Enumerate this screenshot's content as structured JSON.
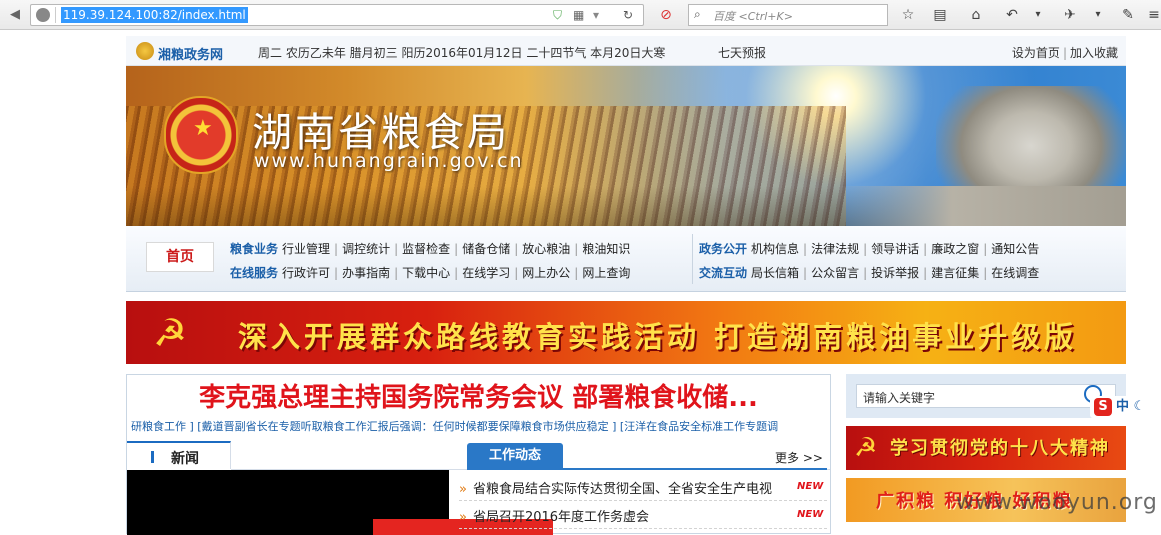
{
  "browser": {
    "url": "119.39.124.100:82/index.html",
    "search_placeholder": "百度 <Ctrl+K>"
  },
  "topbar": {
    "site_name": "湘粮政务网",
    "date": "周二 农历乙未年 腊月初三 阳历2016年01月12日 二十四节气 本月20日大寒",
    "weather": "七天预报",
    "link_homepage": "设为首页",
    "link_favorite": "加入收藏"
  },
  "banner": {
    "title": "湖南省粮食局",
    "domain": "www.hunangrain.gov.cn"
  },
  "nav": {
    "home": "首页",
    "row1_cat": "粮食业务",
    "row1_items": [
      "行业管理",
      "调控统计",
      "监督检查",
      "储备仓储",
      "放心粮油",
      "粮油知识"
    ],
    "row2_cat": "在线服务",
    "row2_items": [
      "行政许可",
      "办事指南",
      "下载中心",
      "在线学习",
      "网上办公",
      "网上查询"
    ],
    "row3_cat": "政务公开",
    "row3_items": [
      "机构信息",
      "法律法规",
      "领导讲话",
      "廉政之窗",
      "通知公告"
    ],
    "row4_cat": "交流互动",
    "row4_items": [
      "局长信箱",
      "公众留言",
      "投诉举报",
      "建言征集",
      "在线调查"
    ]
  },
  "slogan": {
    "text": "深入开展群众路线教育实践活动  打造湖南粮油事业升级版"
  },
  "news": {
    "headline": "李克强总理主持国务院常务会议 部署粮食收储...",
    "ticker": "研粮食工作 ] [戴道晋副省长在专题听取粮食工作汇报后强调：任何时候都要保障粮食市场供应稳定 ] [汪洋在食品安全标准工作专题调",
    "tab_news": "新闻",
    "tab_work": "工作动态",
    "more": "更多 >>",
    "items": [
      {
        "title": "省粮食局结合实际传达贯彻全国、全省安全生产电视",
        "tag": "NEW"
      },
      {
        "title": "省局召开2016年度工作务虚会",
        "tag": "NEW"
      }
    ]
  },
  "sidebar": {
    "search_placeholder": "请输入关键字",
    "ime_label": "中",
    "promo1": "学习贯彻党的十八大精神",
    "promo2": "广积粮  积好粮  好积粮"
  },
  "watermark": "www.wooyun.org"
}
